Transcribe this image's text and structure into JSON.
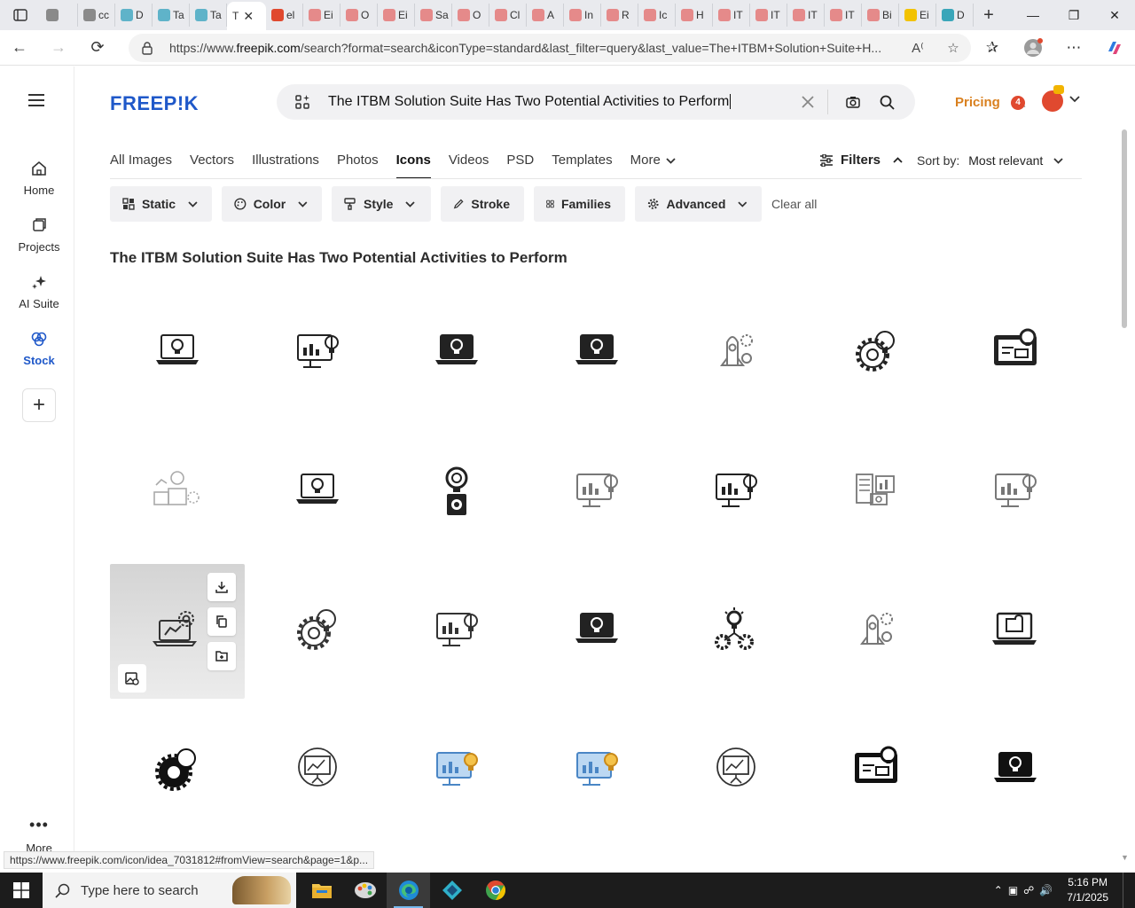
{
  "browser": {
    "tabs": [
      {
        "label": "",
        "color": "#8a8a8a"
      },
      {
        "label": "cc",
        "color": "#8a8a8a"
      },
      {
        "label": "D",
        "color": "#5fb3c9"
      },
      {
        "label": "Ta",
        "color": "#5fb3c9"
      },
      {
        "label": "Ta",
        "color": "#5fb3c9"
      },
      {
        "label": "T",
        "color": "#ffffff",
        "active": true
      },
      {
        "label": "el",
        "color": "#e0492f"
      },
      {
        "label": "Ei",
        "color": "#e58a8a"
      },
      {
        "label": "O",
        "color": "#e58a8a"
      },
      {
        "label": "Ei",
        "color": "#e58a8a"
      },
      {
        "label": "Sa",
        "color": "#e58a8a"
      },
      {
        "label": "O",
        "color": "#e58a8a"
      },
      {
        "label": "Cl",
        "color": "#e58a8a"
      },
      {
        "label": "A",
        "color": "#e58a8a"
      },
      {
        "label": "In",
        "color": "#e58a8a"
      },
      {
        "label": "R",
        "color": "#e58a8a"
      },
      {
        "label": "Ic",
        "color": "#e58a8a"
      },
      {
        "label": "H",
        "color": "#e58a8a"
      },
      {
        "label": "IT",
        "color": "#e58a8a"
      },
      {
        "label": "IT",
        "color": "#e58a8a"
      },
      {
        "label": "IT",
        "color": "#e58a8a"
      },
      {
        "label": "IT",
        "color": "#e58a8a"
      },
      {
        "label": "Bi",
        "color": "#e58a8a"
      },
      {
        "label": "Ei",
        "color": "#f2c200"
      },
      {
        "label": "D",
        "color": "#3aa6b9"
      }
    ],
    "url_prefix": "https://www.",
    "url_domain": "freepik.com",
    "url_rest": "/search?format=search&iconType=standard&last_filter=query&last_value=The+ITBM+Solution+Suite+H..."
  },
  "rail": {
    "items": [
      {
        "label": "Home"
      },
      {
        "label": "Projects"
      },
      {
        "label": "AI Suite"
      },
      {
        "label": "Stock"
      }
    ],
    "more_label": "More"
  },
  "header": {
    "logo": "FREEP!K",
    "search_value": "The ITBM Solution Suite Has Two Potential Activities to Perform",
    "pricing": "Pricing",
    "notif_count": "4"
  },
  "categories": [
    {
      "label": "All Images"
    },
    {
      "label": "Vectors"
    },
    {
      "label": "Illustrations"
    },
    {
      "label": "Photos"
    },
    {
      "label": "Icons",
      "active": true
    },
    {
      "label": "Videos"
    },
    {
      "label": "PSD"
    },
    {
      "label": "Templates"
    },
    {
      "label": "More"
    }
  ],
  "filters_label": "Filters",
  "sort": {
    "label": "Sort by:",
    "value": "Most relevant"
  },
  "chips": [
    {
      "label": "Static"
    },
    {
      "label": "Color"
    },
    {
      "label": "Style"
    },
    {
      "label": "Stroke"
    },
    {
      "label": "Families"
    },
    {
      "label": "Advanced"
    }
  ],
  "clear_all": "Clear all",
  "result_title": "The ITBM Solution Suite Has Two Potential Activities to Perform",
  "icons": [
    {
      "name": "laptop-bulb-outline",
      "kind": "laptop-bulb",
      "style": "outline",
      "color": "#222"
    },
    {
      "name": "monitor-bulb-chart",
      "kind": "monitor-chart",
      "style": "mixed",
      "color": "#222"
    },
    {
      "name": "laptop-bulb-solid",
      "kind": "laptop-bulb",
      "style": "solid",
      "color": "#222"
    },
    {
      "name": "laptop-bulb-glyph",
      "kind": "laptop-bulb",
      "style": "glyph",
      "color": "#222"
    },
    {
      "name": "rocket-gear-outline",
      "kind": "rocket",
      "style": "outline",
      "color": "#777"
    },
    {
      "name": "gear-bulb-outline",
      "kind": "gear-bulb",
      "style": "outline",
      "color": "#222"
    },
    {
      "name": "dashboard-bulb-solid",
      "kind": "dashboard",
      "style": "solid",
      "color": "#222"
    },
    {
      "name": "workspace-bulb-outline",
      "kind": "workspace",
      "style": "outline",
      "color": "#aaa"
    },
    {
      "name": "laptop-bulb-line",
      "kind": "laptop-bulb",
      "style": "outline",
      "color": "#222"
    },
    {
      "name": "bulb-gear-solid",
      "kind": "bulb-gear",
      "style": "solid",
      "color": "#222"
    },
    {
      "name": "monitor-idea-outline",
      "kind": "monitor-chart",
      "style": "outline",
      "color": "#777"
    },
    {
      "name": "monitor-chart-bulb",
      "kind": "monitor-chart",
      "style": "mixed",
      "color": "#222"
    },
    {
      "name": "checklist-bulb-outline",
      "kind": "checklist",
      "style": "outline",
      "color": "#777"
    },
    {
      "name": "monitor-idea-line",
      "kind": "monitor-chart",
      "style": "outline",
      "color": "#777"
    },
    {
      "name": "laptop-bulb-gear-line",
      "kind": "laptop-gear",
      "style": "outline",
      "color": "#333",
      "hover": true
    },
    {
      "name": "gear-bulb-line",
      "kind": "gear-bulb",
      "style": "outline",
      "color": "#333"
    },
    {
      "name": "monitor-chart-bulb-line",
      "kind": "monitor-chart",
      "style": "outline",
      "color": "#333"
    },
    {
      "name": "laptop-bulb-solid-2",
      "kind": "laptop-bulb",
      "style": "glyph",
      "color": "#222"
    },
    {
      "name": "bulb-two-gears",
      "kind": "bulb-gears",
      "style": "mixed",
      "color": "#222"
    },
    {
      "name": "rocket-gear-line",
      "kind": "rocket",
      "style": "outline",
      "color": "#777"
    },
    {
      "name": "laptop-puzzle-line",
      "kind": "laptop-puzzle",
      "style": "outline",
      "color": "#222"
    },
    {
      "name": "gear-bulb-solid",
      "kind": "gear-bulb",
      "style": "solid",
      "color": "#111"
    },
    {
      "name": "presentation-chart-outline",
      "kind": "presentation",
      "style": "outline",
      "color": "#333"
    },
    {
      "name": "monitor-bulb-color",
      "kind": "monitor-chart",
      "style": "color",
      "color": "#4a86c5"
    },
    {
      "name": "monitor-bulb-color-2",
      "kind": "monitor-chart",
      "style": "color",
      "color": "#4a86c5"
    },
    {
      "name": "presentation-chart-line",
      "kind": "presentation",
      "style": "outline",
      "color": "#333"
    },
    {
      "name": "dashboard-gears-solid",
      "kind": "dashboard",
      "style": "solid",
      "color": "#111"
    },
    {
      "name": "laptop-bulb-solid-3",
      "kind": "laptop-bulb",
      "style": "solid",
      "color": "#111"
    }
  ],
  "status_url": "https://www.freepik.com/icon/idea_7031812#fromView=search&page=1&p...",
  "taskbar": {
    "search_placeholder": "Type here to search",
    "time": "5:16 PM",
    "date": "7/1/2025"
  }
}
